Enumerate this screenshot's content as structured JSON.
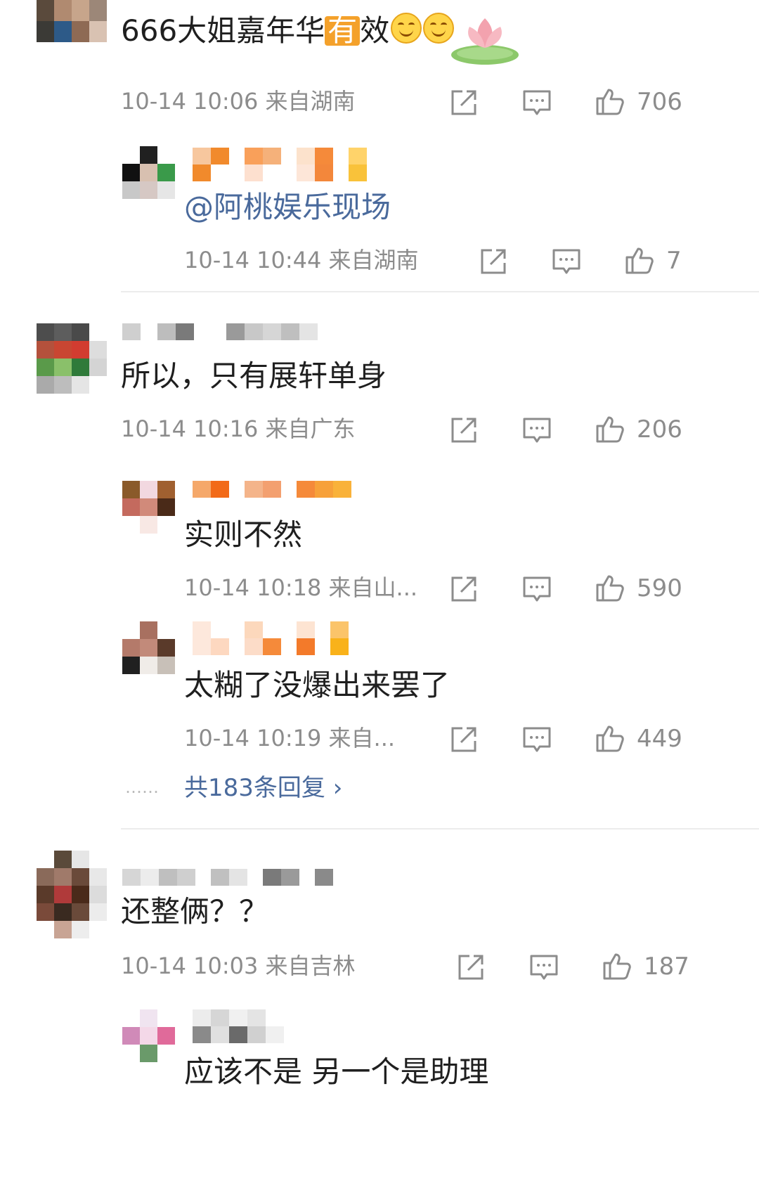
{
  "colors": {
    "link": "#4a6a9c",
    "meta": "#8c8c8c",
    "accent": "#f4a12b"
  },
  "icons": {
    "share": "share-icon",
    "comment": "comment-icon",
    "like": "thumbs-up-icon"
  },
  "comments": [
    {
      "text_pre": "666大姐嘉年华",
      "text_badge": "有",
      "text_post": "效",
      "meta": "10-14 10:06  来自湖南",
      "likes": "706",
      "replies": [
        {
          "mention": "@阿桃娱乐现场",
          "meta": "10-14 10:44  来自湖南",
          "likes": "7"
        }
      ]
    },
    {
      "text": "所以，只有展轩单身",
      "meta": "10-14 10:16  来自广东",
      "likes": "206",
      "replies": [
        {
          "text": "实则不然",
          "meta": "10-14 10:18  来自山...",
          "likes": "590"
        },
        {
          "text": "太糊了没爆出来罢了",
          "meta": "10-14 10:19  来自...",
          "likes": "449"
        }
      ],
      "more_replies": "共183条回复 ›",
      "ellipsis": "……"
    },
    {
      "text": "还整俩？？",
      "meta": "10-14 10:03  来自吉林",
      "likes": "187",
      "replies": [
        {
          "text": "应该不是 另一个是助理"
        }
      ]
    }
  ]
}
